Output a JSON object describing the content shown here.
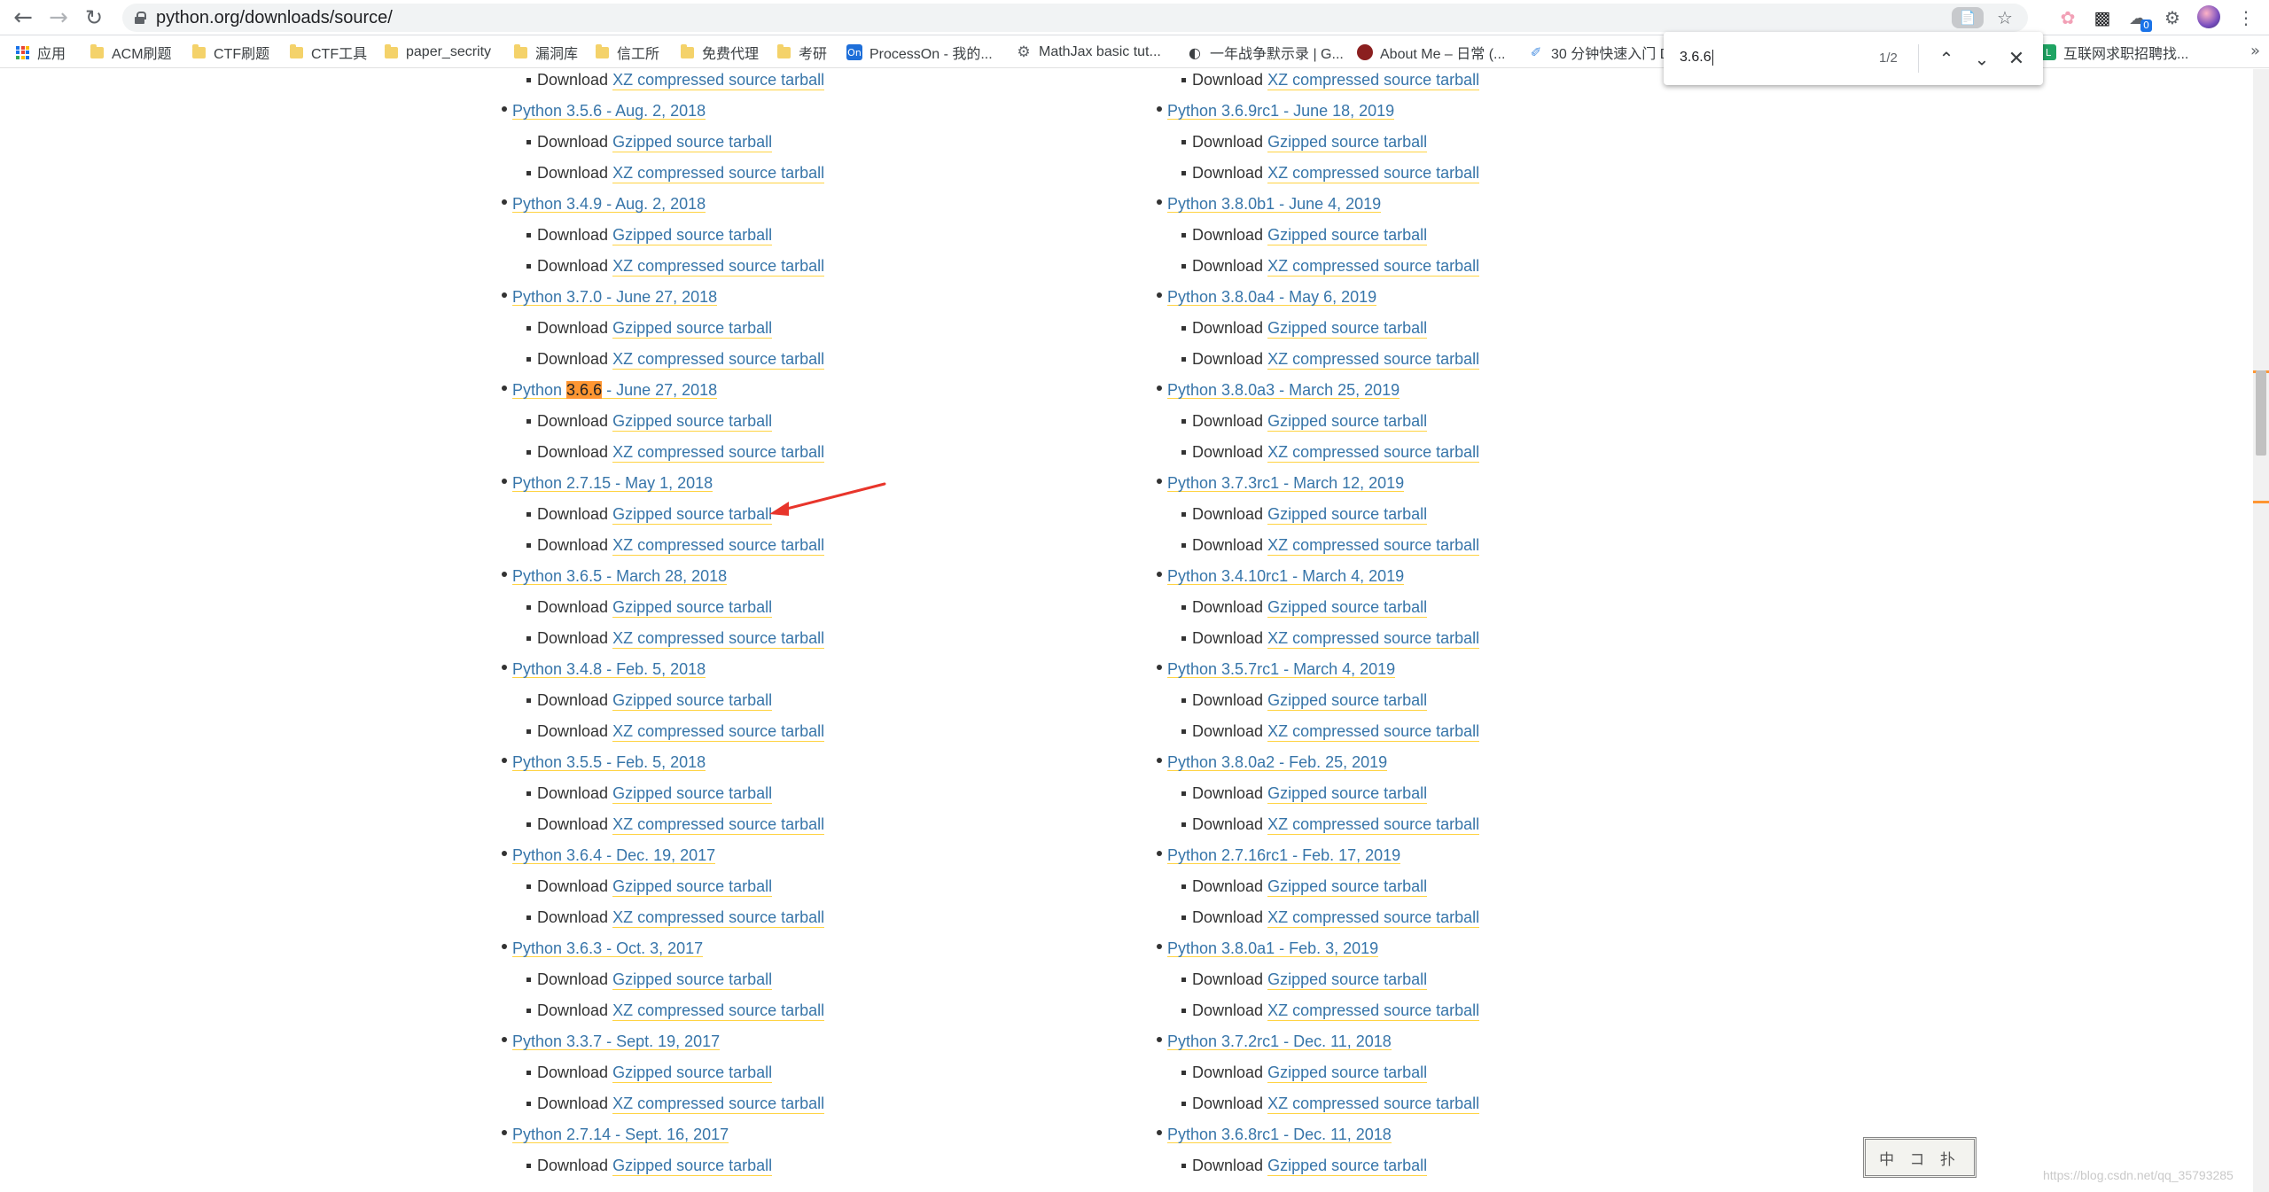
{
  "browser": {
    "url": "python.org/downloads/source/",
    "extensions": {
      "badge_count": "0"
    }
  },
  "bookmarks": [
    {
      "label": "应用",
      "icon": "apps-grid-icon"
    },
    {
      "label": "ACM刷题",
      "icon": "folder-icon"
    },
    {
      "label": "CTF刷题",
      "icon": "folder-icon"
    },
    {
      "label": "CTF工具",
      "icon": "folder-icon"
    },
    {
      "label": "paper_secrity",
      "icon": "folder-icon"
    },
    {
      "label": "漏洞库",
      "icon": "folder-icon"
    },
    {
      "label": "信工所",
      "icon": "folder-icon"
    },
    {
      "label": "免费代理",
      "icon": "folder-icon"
    },
    {
      "label": "考研",
      "icon": "folder-icon"
    },
    {
      "label": "ProcessOn - 我的...",
      "icon": "processon-icon",
      "icon_text": "On"
    },
    {
      "label": "MathJax basic tut...",
      "icon": "gear-icon"
    },
    {
      "label": "一年战争默示录 | G...",
      "icon": "globe-icon"
    },
    {
      "label": "About Me – 日常 (...",
      "icon": "avatar-icon"
    },
    {
      "label": "30 分钟快速入门 D",
      "icon": "docker-icon"
    },
    {
      "label": "互联网求职招聘找...",
      "icon": "job-site-icon"
    }
  ],
  "find_bar": {
    "query": "3.6.6",
    "count": "1/2"
  },
  "releases": {
    "left": [
      {
        "title": "",
        "downloads": [],
        "partial": "Download",
        "partial_link": "XZ compressed source tarball"
      },
      {
        "title": "Python 3.5.6 - Aug. 2, 2018"
      },
      {
        "title": "Python 3.4.9 - Aug. 2, 2018"
      },
      {
        "title": "Python 3.7.0 - June 27, 2018"
      },
      {
        "title_pre": "Python ",
        "title_hl": "3.6.6",
        "title_post": " - June 27, 2018"
      },
      {
        "title": "Python 2.7.15 - May 1, 2018"
      },
      {
        "title": "Python 3.6.5 - March 28, 2018"
      },
      {
        "title": "Python 3.4.8 - Feb. 5, 2018"
      },
      {
        "title": "Python 3.5.5 - Feb. 5, 2018"
      },
      {
        "title": "Python 3.6.4 - Dec. 19, 2017"
      },
      {
        "title": "Python 3.6.3 - Oct. 3, 2017"
      },
      {
        "title": "Python 3.3.7 - Sept. 19, 2017"
      },
      {
        "title": "Python 2.7.14 - Sept. 16, 2017"
      }
    ],
    "right": [
      {
        "title": ""
      },
      {
        "title": "Python 3.6.9rc1 - June 18, 2019"
      },
      {
        "title": "Python 3.8.0b1 - June 4, 2019"
      },
      {
        "title": "Python 3.8.0a4 - May 6, 2019"
      },
      {
        "title": "Python 3.8.0a3 - March 25, 2019"
      },
      {
        "title": "Python 3.7.3rc1 - March 12, 2019"
      },
      {
        "title": "Python 3.4.10rc1 - March 4, 2019"
      },
      {
        "title": "Python 3.5.7rc1 - March 4, 2019"
      },
      {
        "title": "Python 3.8.0a2 - Feb. 25, 2019"
      },
      {
        "title": "Python 2.7.16rc1 - Feb. 17, 2019"
      },
      {
        "title": "Python 3.8.0a1 - Feb. 3, 2019"
      },
      {
        "title": "Python 3.7.2rc1 - Dec. 11, 2018"
      },
      {
        "title": "Python 3.6.8rc1 - Dec. 11, 2018"
      }
    ],
    "download_prefix": "Download",
    "gzip_label": "Gzipped source tarball",
    "xz_label": "XZ compressed source tarball"
  },
  "stamp_text": "中 コ 扑",
  "watermark": "https://blog.csdn.net/qq_35793285",
  "colors": {
    "link": "#3775a9",
    "link_underline": "#ffd343",
    "find_highlight": "#ff9632",
    "arrow": "#e8352b"
  }
}
